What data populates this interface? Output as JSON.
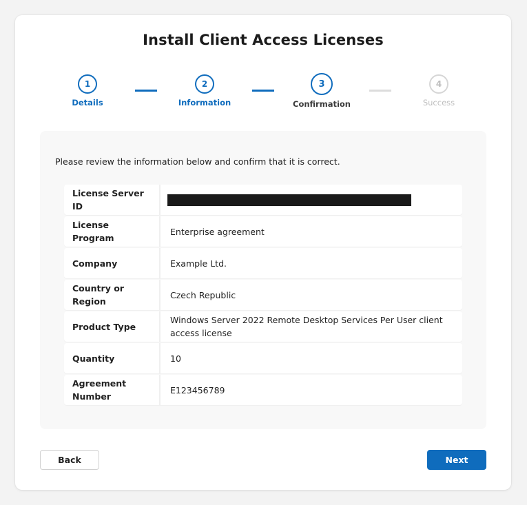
{
  "dialog": {
    "title": "Install Client Access Licenses"
  },
  "stepper": {
    "steps": [
      {
        "number": "1",
        "label": "Details",
        "state": "done"
      },
      {
        "number": "2",
        "label": "Information",
        "state": "done"
      },
      {
        "number": "3",
        "label": "Confirmation",
        "state": "current"
      },
      {
        "number": "4",
        "label": "Success",
        "state": "future"
      }
    ]
  },
  "review": {
    "instructions": "Please review the information below and confirm that it is correct.",
    "rows": [
      {
        "key": "License Server ID",
        "value": ""
      },
      {
        "key": "License Program",
        "value": "Enterprise agreement"
      },
      {
        "key": "Company",
        "value": "Example Ltd."
      },
      {
        "key": "Country or Region",
        "value": "Czech Republic"
      },
      {
        "key": "Product Type",
        "value": "Windows Server 2022 Remote Desktop Services Per User client access license"
      },
      {
        "key": "Quantity",
        "value": "10"
      },
      {
        "key": "Agreement Number",
        "value": "E123456789"
      }
    ]
  },
  "buttons": {
    "back_label": "Back",
    "next_label": "Next"
  },
  "colors": {
    "accent": "#0f6cbd",
    "inactive": "#bdbdbd"
  }
}
